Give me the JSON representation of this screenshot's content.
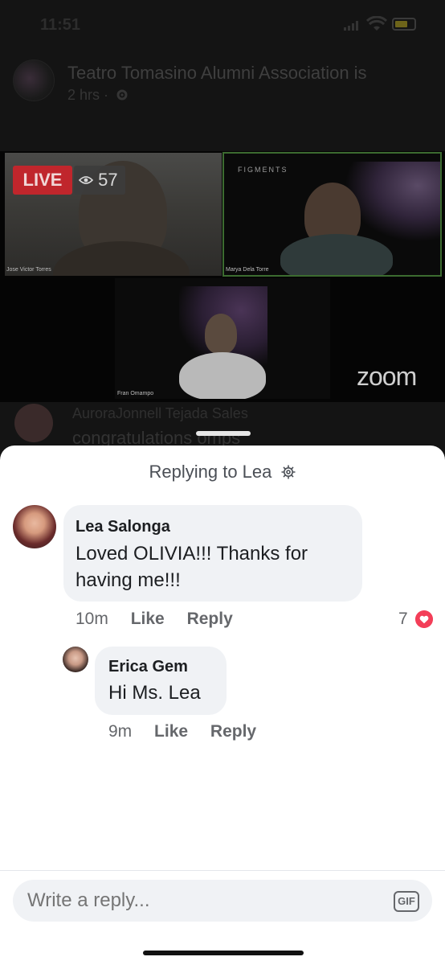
{
  "status_bar": {
    "time": "11:51"
  },
  "post": {
    "title": "Teatro Tomasino Alumni Association is",
    "time": "2 hrs ·",
    "privacy_icon": "gear-icon"
  },
  "video": {
    "live_label": "LIVE",
    "viewers": "57",
    "participants": [
      "Jose Victor Torres",
      "Marya Dela Torre",
      "Fran Omampo"
    ],
    "brand_mark": "FIGMENTS",
    "zoom_label": "zoom"
  },
  "background_comment": {
    "name": "AuroraJonnell Tejada Sales",
    "text": "congratulations omps"
  },
  "sheet": {
    "title": "Replying to Lea",
    "title_icon": "gear-icon"
  },
  "comments": [
    {
      "name": "Lea Salonga",
      "text": "Loved OLIVIA!!! Thanks for having me!!!",
      "time": "10m",
      "like": "Like",
      "reply": "Reply",
      "reactions": "7",
      "reaction_icon": "heart-icon",
      "reaction_color": "#f33e58"
    },
    {
      "name": "Erica Gem",
      "text": "Hi Ms. Lea",
      "time": "9m",
      "like": "Like",
      "reply": "Reply"
    }
  ],
  "composer": {
    "placeholder": "Write a reply...",
    "gif_label": "GIF"
  },
  "colors": {
    "live_red": "#c0262c",
    "bubble_bg": "#f0f2f5",
    "meta_text": "#65676b"
  }
}
